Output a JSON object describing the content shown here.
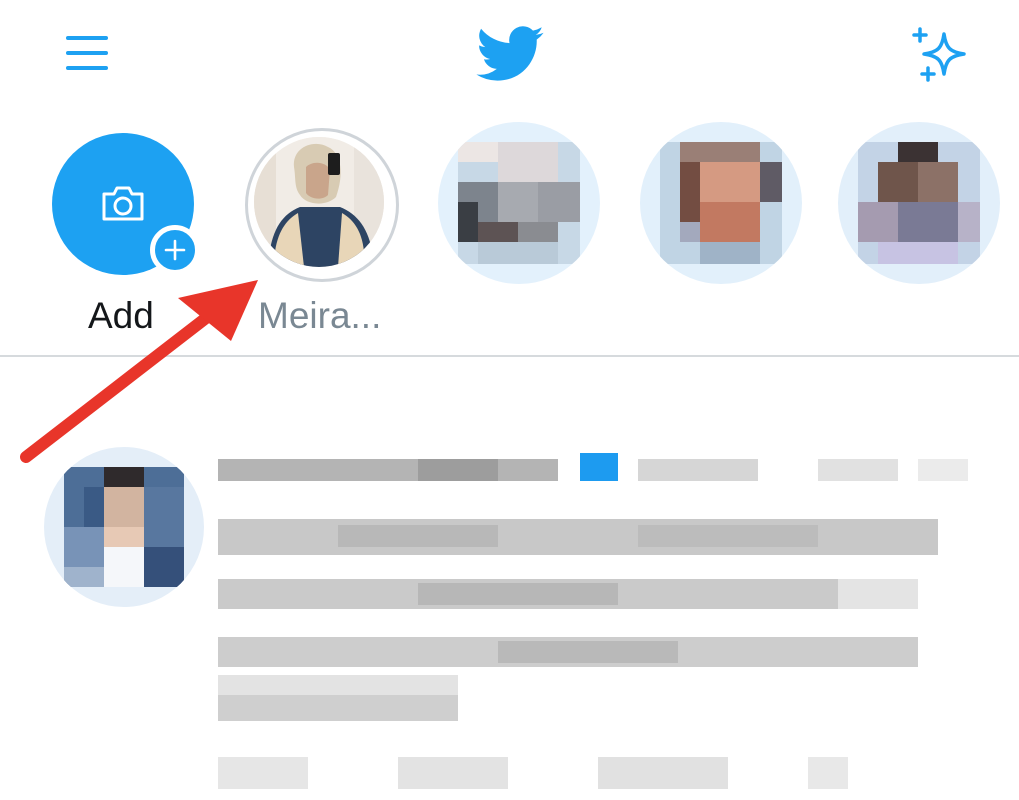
{
  "header": {
    "menu_icon": "hamburger-menu-icon",
    "logo_icon": "twitter-bird-icon",
    "sparkle_icon": "sparkle-icon",
    "accent_color": "#1da1f2"
  },
  "fleets": {
    "add": {
      "label": "Add",
      "icons": [
        "camera-icon",
        "plus-icon"
      ]
    },
    "user": {
      "label": "Meira..."
    }
  },
  "annotation": {
    "arrow_color": "#e8352a"
  }
}
